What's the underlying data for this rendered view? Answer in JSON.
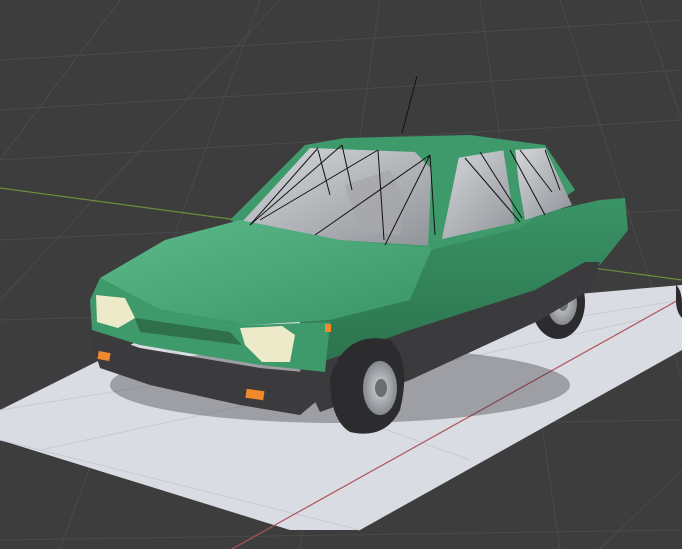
{
  "viewport": {
    "background": "#3d3d3d",
    "grid_line_color": "#4a4a4a",
    "x_axis_color": "#b0545b",
    "y_axis_color": "#6c8e3a",
    "ground_plane_color": "#d9dce2"
  },
  "scene_object": {
    "kind": "low-poly sedan car model",
    "body_color": "#3f9a6b",
    "body_shadow_color": "#2f7a52",
    "bumper_color": "#3b3b3d",
    "headlight_color": "#eceac8",
    "indicator_color": "#f08a2c",
    "wheel_color": "#2c2c2e",
    "hubcap_color": "#a7a9ad",
    "window_color": "#bdbfc4",
    "wireframe_color": "#111111"
  }
}
